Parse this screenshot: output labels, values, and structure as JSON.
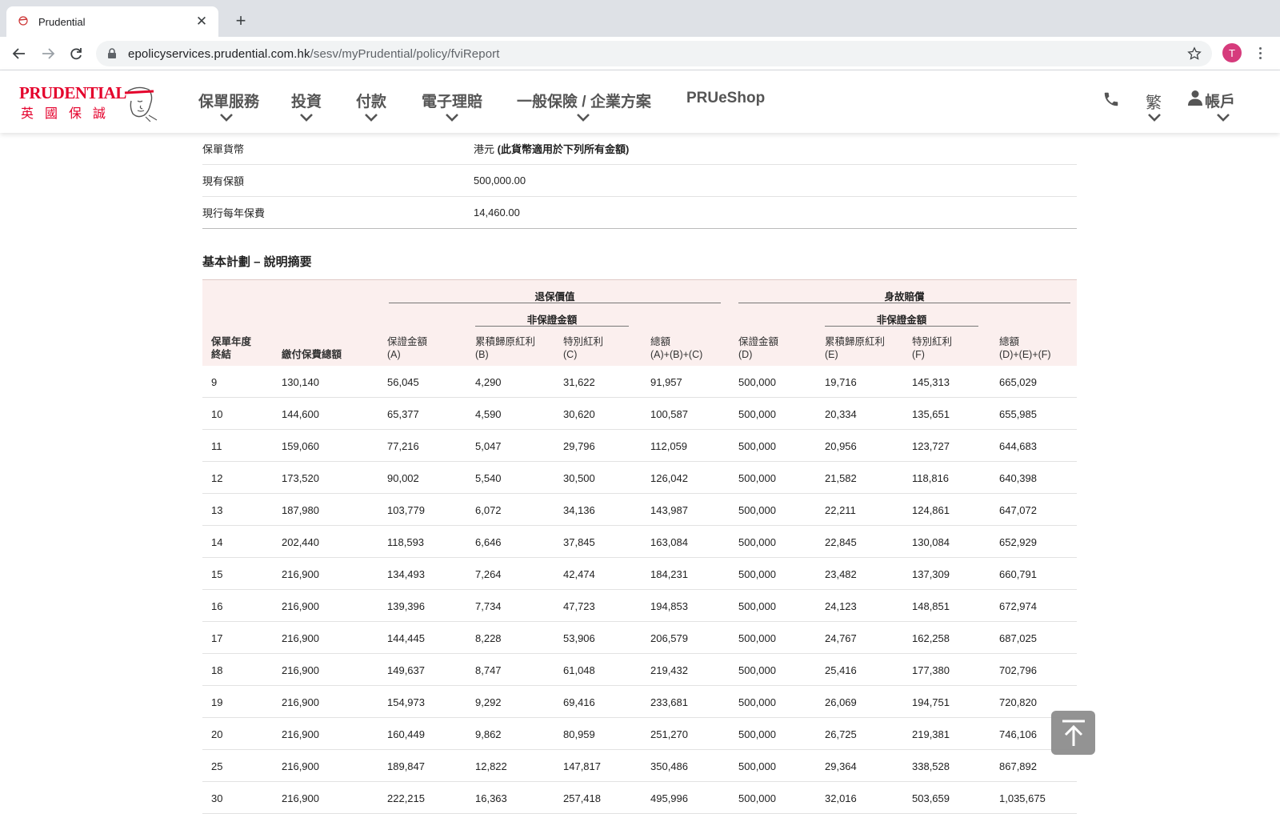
{
  "browser": {
    "tab_title": "Prudential",
    "url_host": "epolicyservices.prudential.com.hk",
    "url_path": "/sesv/myPrudential/policy/fviReport",
    "profile_initial": "T"
  },
  "header": {
    "logo_en": "PRUDENTIAL",
    "logo_zh": "英國保誠",
    "nav": [
      {
        "label": "保單服務"
      },
      {
        "label": "投資"
      },
      {
        "label": "付款"
      },
      {
        "label": "電子理賠"
      },
      {
        "label": "一般保險 / 企業方案"
      },
      {
        "label": "PRUeShop"
      }
    ],
    "lang": "繁",
    "account": "帳戶"
  },
  "policy_info": [
    {
      "label": "保單貨幣",
      "value_prefix": "港元 ",
      "value_bold": "(此貨幣適用於下列所有金額)"
    },
    {
      "label": "現有保額",
      "value_prefix": "500,000.00",
      "value_bold": ""
    },
    {
      "label": "現行每年保費",
      "value_prefix": "14,460.00",
      "value_bold": ""
    }
  ],
  "section_title": "基本計劃 – 說明摘要",
  "table": {
    "group_surrender": "退保價值",
    "group_death": "身故賠償",
    "sub_nonguaranteed": "非保證金額",
    "columns": [
      {
        "l1": "保單年度",
        "l2": "終結"
      },
      {
        "l1": "",
        "l2": "繳付保費總額"
      },
      {
        "l1": "保證金額",
        "l2": "(A)"
      },
      {
        "l1": "累積歸原紅利",
        "l2": "(B)"
      },
      {
        "l1": "特別紅利",
        "l2": "(C)"
      },
      {
        "l1": "總額",
        "l2": "(A)+(B)+(C)"
      },
      {
        "l1": "保證金額",
        "l2": "(D)"
      },
      {
        "l1": "累積歸原紅利",
        "l2": "(E)"
      },
      {
        "l1": "特別紅利",
        "l2": "(F)"
      },
      {
        "l1": "總額",
        "l2": "(D)+(E)+(F)"
      }
    ],
    "rows": [
      [
        "9",
        "130,140",
        "56,045",
        "4,290",
        "31,622",
        "91,957",
        "500,000",
        "19,716",
        "145,313",
        "665,029"
      ],
      [
        "10",
        "144,600",
        "65,377",
        "4,590",
        "30,620",
        "100,587",
        "500,000",
        "20,334",
        "135,651",
        "655,985"
      ],
      [
        "11",
        "159,060",
        "77,216",
        "5,047",
        "29,796",
        "112,059",
        "500,000",
        "20,956",
        "123,727",
        "644,683"
      ],
      [
        "12",
        "173,520",
        "90,002",
        "5,540",
        "30,500",
        "126,042",
        "500,000",
        "21,582",
        "118,816",
        "640,398"
      ],
      [
        "13",
        "187,980",
        "103,779",
        "6,072",
        "34,136",
        "143,987",
        "500,000",
        "22,211",
        "124,861",
        "647,072"
      ],
      [
        "14",
        "202,440",
        "118,593",
        "6,646",
        "37,845",
        "163,084",
        "500,000",
        "22,845",
        "130,084",
        "652,929"
      ],
      [
        "15",
        "216,900",
        "134,493",
        "7,264",
        "42,474",
        "184,231",
        "500,000",
        "23,482",
        "137,309",
        "660,791"
      ],
      [
        "16",
        "216,900",
        "139,396",
        "7,734",
        "47,723",
        "194,853",
        "500,000",
        "24,123",
        "148,851",
        "672,974"
      ],
      [
        "17",
        "216,900",
        "144,445",
        "8,228",
        "53,906",
        "206,579",
        "500,000",
        "24,767",
        "162,258",
        "687,025"
      ],
      [
        "18",
        "216,900",
        "149,637",
        "8,747",
        "61,048",
        "219,432",
        "500,000",
        "25,416",
        "177,380",
        "702,796"
      ],
      [
        "19",
        "216,900",
        "154,973",
        "9,292",
        "69,416",
        "233,681",
        "500,000",
        "26,069",
        "194,751",
        "720,820"
      ],
      [
        "20",
        "216,900",
        "160,449",
        "9,862",
        "80,959",
        "251,270",
        "500,000",
        "26,725",
        "219,381",
        "746,106"
      ],
      [
        "25",
        "216,900",
        "189,847",
        "12,822",
        "147,817",
        "350,486",
        "500,000",
        "29,364",
        "338,528",
        "867,892"
      ],
      [
        "30",
        "216,900",
        "222,215",
        "16,363",
        "257,418",
        "495,996",
        "500,000",
        "32,016",
        "503,659",
        "1,035,675"
      ]
    ]
  },
  "colors": {
    "brand": "#e4002b",
    "table_head_bg": "#fbefee",
    "back_to_top": "#8e8e8e"
  }
}
